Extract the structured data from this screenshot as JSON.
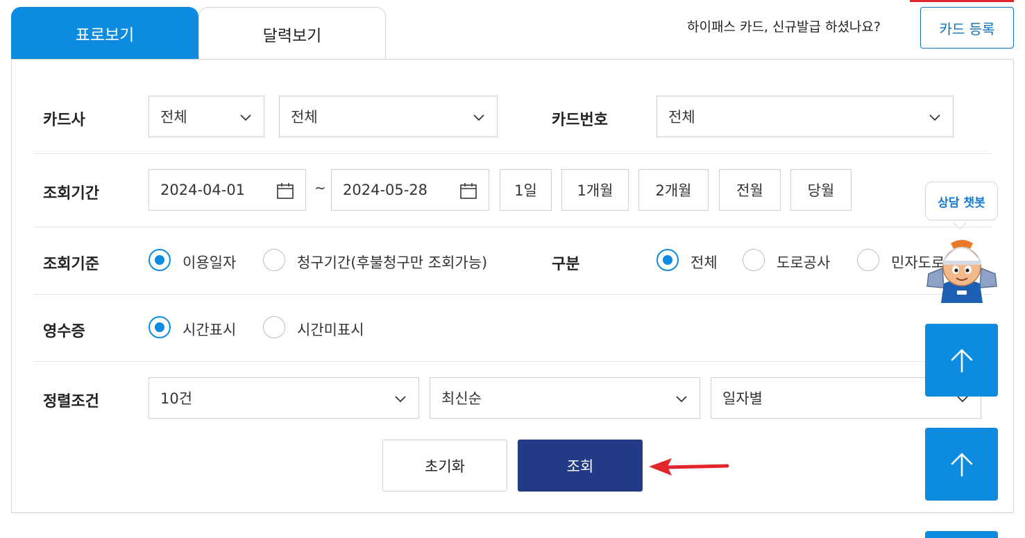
{
  "tabs": [
    {
      "label": "표로보기",
      "active": true
    },
    {
      "label": "달력보기",
      "active": false
    }
  ],
  "promo": {
    "text": "하이패스 카드, 신규발급 하셨나요?",
    "button_label": "카드 등록"
  },
  "filters": {
    "card_company": {
      "label": "카드사",
      "select1": "전체",
      "select2": "전체"
    },
    "card_number": {
      "label": "카드번호",
      "select": "전체"
    },
    "period": {
      "label": "조회기간",
      "start_date": "2024-04-01",
      "separator": "~",
      "end_date": "2024-05-28",
      "quick_buttons": [
        "1일",
        "1개월",
        "2개월",
        "전월",
        "당월"
      ]
    },
    "basis": {
      "label": "조회기준",
      "options": [
        {
          "label": "이용일자",
          "selected": true
        },
        {
          "label": "청구기간(후불청구만 조회가능)",
          "selected": false
        }
      ]
    },
    "category": {
      "label": "구분",
      "options": [
        {
          "label": "전체",
          "selected": true
        },
        {
          "label": "도로공사",
          "selected": false
        },
        {
          "label": "민자도로",
          "selected": false
        }
      ]
    },
    "receipt": {
      "label": "영수증",
      "options": [
        {
          "label": "시간표시",
          "selected": true
        },
        {
          "label": "시간미표시",
          "selected": false
        }
      ]
    },
    "sort": {
      "label": "정렬조건",
      "count": "10건",
      "order": "최신순",
      "group": "일자별"
    }
  },
  "actions": {
    "reset_label": "초기화",
    "search_label": "조회"
  },
  "chat": {
    "label": "상담 챗봇"
  },
  "colors": {
    "primary_blue": "#0c8be0",
    "search_navy": "#233a86",
    "annotation_red": "#e1252b"
  },
  "icons": [
    "chevron-down-icon",
    "calendar-icon",
    "arrow-up-icon",
    "red-arrow-annotation",
    "mascot-icon"
  ]
}
